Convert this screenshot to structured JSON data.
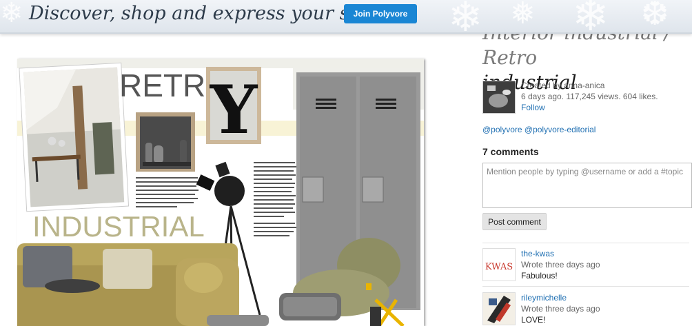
{
  "banner": {
    "tagline": "Discover, shop and express your style",
    "join_label": "Join Polyvore"
  },
  "collage": {
    "retro_text": "RETRO",
    "industrial_text": "INDUSTRIAL",
    "poster_letter": "Y"
  },
  "set": {
    "title_line1": "Interior industrial / Retro",
    "title_line2": "industrial",
    "created_by_prefix": "Created by ",
    "creator": "anna-anica",
    "stats": "6 days ago. 117,245 views. 604 likes.",
    "follow_label": "Follow",
    "tag1": "@polyvore",
    "tag2": "@polyvore-editorial"
  },
  "comments": {
    "heading": "7 comments",
    "placeholder": "Mention people by typing @username or add a #topic",
    "post_label": "Post comment",
    "items": [
      {
        "user": "the-kwas",
        "time": "Wrote three days ago",
        "text": "Fabulous!",
        "avatar_text": "KWAS"
      },
      {
        "user": "rileymichelle",
        "time": "Wrote three days ago",
        "text": "LOVE!"
      }
    ]
  },
  "colors": {
    "join_button": "#1a86d4",
    "link": "#1f6fb2"
  }
}
